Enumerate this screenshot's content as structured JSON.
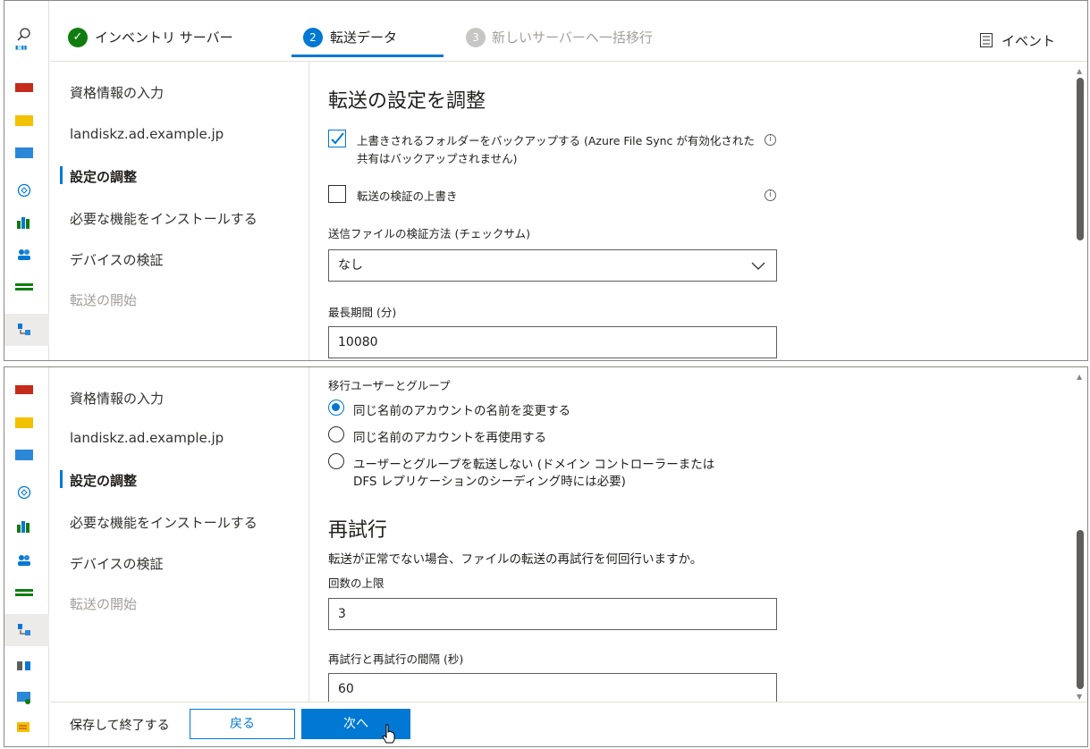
{
  "header": {
    "steps": [
      {
        "number": "✓",
        "label": "インベントリ サーバー",
        "state": "done"
      },
      {
        "number": "2",
        "label": "転送データ",
        "state": "active"
      },
      {
        "number": "3",
        "label": "新しいサーバーへ一括移行",
        "state": "disabled"
      }
    ],
    "events_label": "イベント"
  },
  "nav": {
    "items": [
      {
        "label": "資格情報の入力",
        "state": "normal"
      },
      {
        "label": "landiskz.ad.example.jp",
        "state": "normal"
      },
      {
        "label": "設定の調整",
        "state": "active"
      },
      {
        "label": "必要な機能をインストールする",
        "state": "normal"
      },
      {
        "label": "デバイスの検証",
        "state": "normal"
      },
      {
        "label": "転送の開始",
        "state": "disabled"
      }
    ]
  },
  "top": {
    "title": "転送の設定を調整",
    "backup_checkbox_label_line1": "上書きされるフォルダーをバックアップする (Azure File Sync が有効化された",
    "backup_checkbox_label_line2": "共有はバックアップされません)",
    "backup_checked": true,
    "override_checkbox_label": "転送の検証の上書き",
    "override_checked": false,
    "checksum_label": "送信ファイルの検証方法 (チェックサム)",
    "checksum_value": "なし",
    "max_duration_label": "最長期間 (分)",
    "max_duration_value": "10080"
  },
  "bottom": {
    "users_groups_label": "移行ユーザーとグループ",
    "radio_options": [
      {
        "line1": "同じ名前のアカウントの名前を変更する",
        "line2": "",
        "selected": true
      },
      {
        "line1": "同じ名前のアカウントを再使用する",
        "line2": "",
        "selected": false
      },
      {
        "line1": "ユーザーとグループを転送しない (ドメイン コントローラーまたは",
        "line2": "DFS レプリケーションのシーディング時には必要)",
        "selected": false
      }
    ],
    "retry_title": "再試行",
    "retry_description": "転送が正常でない場合、ファイルの転送の再試行を何回行いますか。",
    "max_count_label": "回数の上限",
    "max_count_value": "3",
    "interval_label": "再試行と再試行の間隔 (秒)",
    "interval_value": "60"
  },
  "footer": {
    "save_exit_label": "保存して終了する",
    "back_label": "戻る",
    "next_label": "次へ"
  },
  "colors": {
    "accent": "#0078d4",
    "success": "#107c10",
    "disabled": "#a19f9d"
  },
  "info_icon_glyph": "i"
}
